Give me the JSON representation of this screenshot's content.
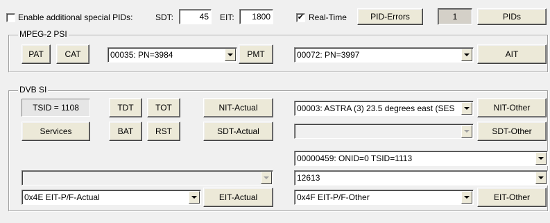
{
  "top": {
    "enable_label": "Enable additional special PIDs:",
    "enable_checked": false,
    "sdt_label": "SDT:",
    "sdt_value": "45",
    "eit_label": "EIT:",
    "eit_value": "1800",
    "realtime_label": "Real-Time",
    "realtime_checked": true,
    "pid_errors_label": "PID-Errors",
    "counter_value": "1",
    "pids_label": "PIDs"
  },
  "mpeg": {
    "legend": "MPEG-2 PSI",
    "pat_label": "PAT",
    "cat_label": "CAT",
    "program_select": "00035: PN=3984",
    "pmt_label": "PMT",
    "ait_select": "00072: PN=3997",
    "ait_label": "AIT"
  },
  "dvb": {
    "legend": "DVB SI",
    "tsid_text": "TSID = 1108",
    "tdt_label": "TDT",
    "tot_label": "TOT",
    "nit_actual_label": "NIT-Actual",
    "network_select": "00003: ASTRA (3) 23.5 degrees east (SES",
    "nit_other_label": "NIT-Other",
    "services_label": "Services",
    "bat_label": "BAT",
    "rst_label": "RST",
    "sdt_actual_label": "SDT-Actual",
    "sdt_other_select": "",
    "sdt_other_label": "SDT-Other",
    "ts_select": "00000459: ONID=0 TSID=1113",
    "left_empty_select": "",
    "service_select": "12613",
    "eit_actual_select": "0x4E EIT-P/F-Actual",
    "eit_actual_label": "EIT-Actual",
    "eit_other_select": "0x4F EIT-P/F-Other",
    "eit_other_label": "EIT-Other"
  }
}
